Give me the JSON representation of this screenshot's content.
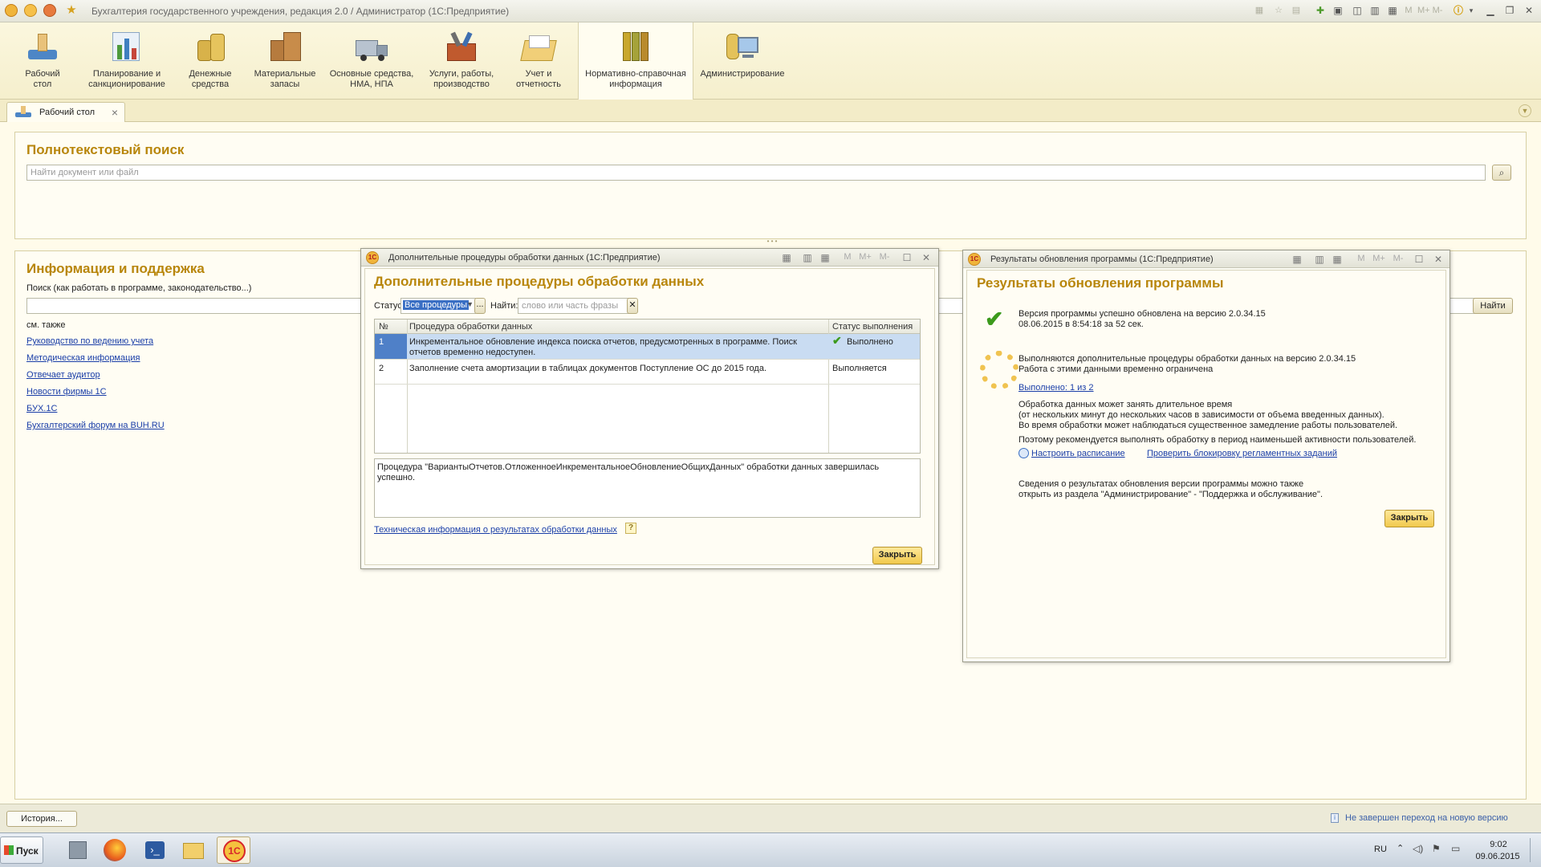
{
  "window": {
    "title": "Бухгалтерия государственного учреждения, редакция 2.0 / Администратор  (1С:Предприятие)",
    "toolbar_mini": [
      "M",
      "M+",
      "M-"
    ]
  },
  "sections": [
    {
      "label": "Рабочий\nстол",
      "icon": "desktop-icon"
    },
    {
      "label": "Планирование и\nсанкционирование",
      "icon": "planning-chart-icon"
    },
    {
      "label": "Денежные\nсредства",
      "icon": "coins-icon"
    },
    {
      "label": "Материальные\nзапасы",
      "icon": "boxes-icon"
    },
    {
      "label": "Основные средства,\nНМА, НПА",
      "icon": "truck-icon"
    },
    {
      "label": "Услуги, работы,\nпроизводство",
      "icon": "toolbox-icon"
    },
    {
      "label": "Учет и\nотчетность",
      "icon": "folder-icon"
    },
    {
      "label": "Нормативно-справочная\nинформация",
      "icon": "binders-icon"
    },
    {
      "label": "Администрирование",
      "icon": "computer-icon"
    }
  ],
  "tabs": {
    "desktop_label": "Рабочий стол"
  },
  "fulltext_search": {
    "title": "Полнотекстовый поиск",
    "placeholder": "Найти документ или файл"
  },
  "info_support": {
    "title": "Информация и поддержка",
    "search_label": "Поиск (как работать в программе, законодательство...)",
    "find_button": "Найти",
    "see_also": "см. также",
    "links": [
      "Руководство по ведению учета",
      "Методическая информация",
      "Отвечает аудитор",
      "Новости фирмы 1С",
      "БУХ.1С",
      "Бухгалтерский форум на BUH.RU"
    ]
  },
  "procedures_window": {
    "title": "Дополнительные процедуры обработки данных  (1С:Предприятие)",
    "heading": "Дополнительные процедуры обработки данных",
    "status_label": "Статус:",
    "status_value": "Все процедуры",
    "more_button": "...",
    "find_label": "Найти:",
    "find_placeholder": "слово или часть фразы",
    "columns": [
      "№",
      "Процедура обработки данных",
      "Статус выполнения"
    ],
    "rows": [
      {
        "num": "1",
        "procedure": "Инкрементальное обновление индекса поиска отчетов, предусмотренных в программе. Поиск отчетов временно недоступен.",
        "status": "Выполнено"
      },
      {
        "num": "2",
        "procedure": "Заполнение счета амортизации в таблицах документов Поступление ОС до 2015 года.",
        "status": "Выполняется"
      }
    ],
    "message": "Процедура \"ВариантыОтчетов.ОтложенноеИнкрементальноеОбновлениеОбщихДанных\" обработки данных завершилась успешно.",
    "tech_link": "Техническая информация о результатах обработки данных",
    "help_glyph": "?",
    "close_button": "Закрыть"
  },
  "update_window": {
    "title": "Результаты обновления программы  (1С:Предприятие)",
    "heading": "Результаты обновления программы",
    "success_line1": "Версия программы успешно обновлена на версию 2.0.34.15",
    "success_line2": "08.06.2015 в 8:54:18 за 52 сек.",
    "progress_line1": "Выполняются дополнительные процедуры обработки данных на версию 2.0.34.15",
    "progress_line2": "Работа с этими данными временно ограничена",
    "done_link": "Выполнено: 1 из 2",
    "note_line1": "Обработка данных может занять длительное время",
    "note_line2": "(от нескольких минут до нескольких часов в зависимости от объема введенных данных).",
    "note_line3": "Во время обработки может наблюдаться существенное замедление работы пользователей.",
    "recommend": "Поэтому рекомендуется выполнять обработку в период наименьшей активности пользователей.",
    "schedule_link": "Настроить расписание",
    "check_link": "Проверить блокировку регламентных заданий",
    "footer_line1": "Сведения о результатах обновления версии программы можно также",
    "footer_line2": "открыть из раздела \"Администрирование\" - \"Поддержка и обслуживание\".",
    "close_button": "Закрыть"
  },
  "statusbar": {
    "history_button": "История...",
    "notice": "Не завершен переход на новую версию"
  },
  "taskbar": {
    "start_label": "Пуск",
    "lang": "RU",
    "time": "9:02",
    "date": "09.06.2015"
  },
  "colors": {
    "accent_title": "#b8860b",
    "link": "#1a3ea8",
    "selected_row": "#b9d3f3",
    "success_check": "#3c9a1c"
  }
}
